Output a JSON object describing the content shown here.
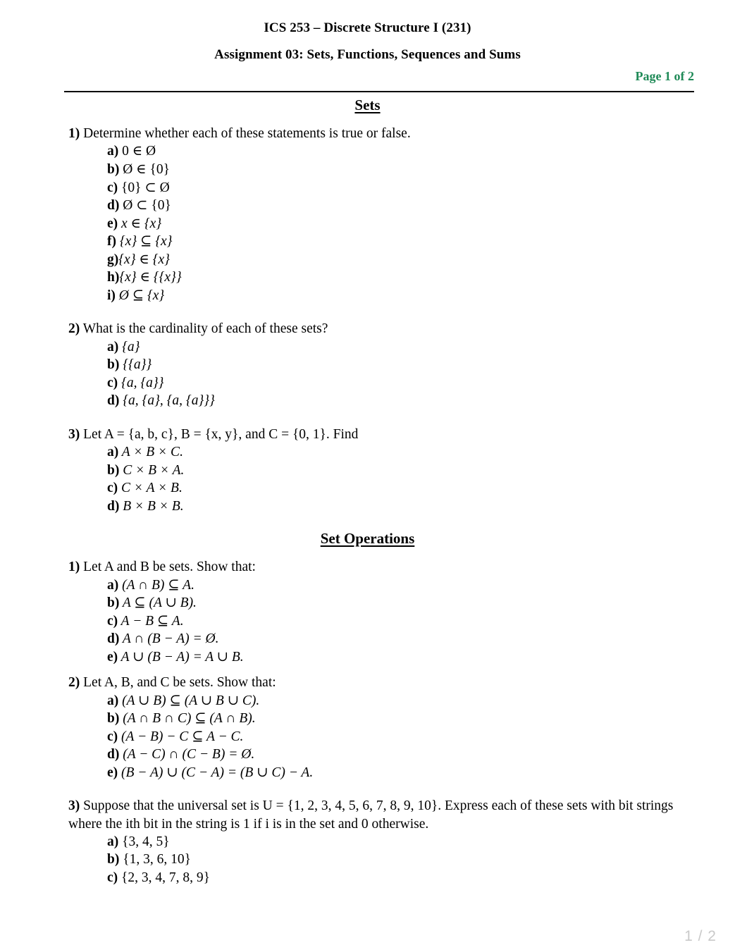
{
  "header": {
    "course_title": "ICS 253 – Discrete Structure I (231)",
    "assignment_title": "Assignment 03: Sets, Functions, Sequences and Sums",
    "page_indicator": "Page 1 of 2",
    "page_indicator_color": "#1f8a57"
  },
  "footer": {
    "page_number": "1 / 2"
  },
  "sections": [
    {
      "heading": "Sets",
      "questions": [
        {
          "number": "1)",
          "prompt": " Determine whether each of these statements is true or false.",
          "items": [
            {
              "label": "a)",
              "text": " 0 ∈ Ø"
            },
            {
              "label": "b)",
              "text": " Ø ∈ {0}"
            },
            {
              "label": "c)",
              "text": " {0} ⊂ Ø"
            },
            {
              "label": "d)",
              "text": " Ø ⊂ {0}"
            },
            {
              "label": "e)",
              "text": " x ∈ {x}"
            },
            {
              "label": "f)",
              "text": " {x} ⊆ {x}"
            },
            {
              "label": "g)",
              "text": "{x} ∈ {x}"
            },
            {
              "label": "h)",
              "text": "{x} ∈ {{x}}"
            },
            {
              "label": "i)",
              "text": " Ø ⊆ {x}"
            }
          ]
        },
        {
          "number": "2)",
          "prompt": " What is the cardinality of each of these sets?",
          "items": [
            {
              "label": "a)",
              "text": " {a}"
            },
            {
              "label": "b)",
              "text": " {{a}}"
            },
            {
              "label": "c)",
              "text": " {a, {a}}"
            },
            {
              "label": "d)",
              "text": " {a, {a}, {a, {a}}}"
            }
          ]
        },
        {
          "number": "3)",
          "prompt": " Let A = {a, b, c}, B = {x, y}, and C = {0, 1}. Find",
          "items": [
            {
              "label": "a)",
              "text": " A × B × C."
            },
            {
              "label": "b)",
              "text": " C × B × A."
            },
            {
              "label": "c)",
              "text": " C × A × B."
            },
            {
              "label": "d)",
              "text": " B × B × B."
            }
          ]
        }
      ]
    },
    {
      "heading": "Set Operations",
      "questions": [
        {
          "number": "1)",
          "prompt": " Let A and B be sets. Show that:",
          "items": [
            {
              "label": "a)",
              "text": " (A ∩ B) ⊆ A."
            },
            {
              "label": "b)",
              "text": " A ⊆ (A ∪ B)."
            },
            {
              "label": "c)",
              "text": " A − B ⊆ A."
            },
            {
              "label": "d)",
              "text": " A ∩ (B − A) = Ø."
            },
            {
              "label": "e)",
              "text": " A ∪ (B − A) = A ∪ B."
            }
          ]
        },
        {
          "number": "2)",
          "prompt": " Let A, B, and C be sets. Show that:",
          "items": [
            {
              "label": "a)",
              "text": " (A ∪ B) ⊆ (A ∪ B ∪ C)."
            },
            {
              "label": "b)",
              "text": " (A ∩ B ∩ C) ⊆ (A ∩ B)."
            },
            {
              "label": "c)",
              "text": " (A − B) − C ⊆ A − C."
            },
            {
              "label": "d)",
              "text": " (A − C) ∩ (C − B) = Ø."
            },
            {
              "label": "e)",
              "text": " (B − A) ∪ (C − A) = (B ∪ C) − A."
            }
          ]
        },
        {
          "number": "3)",
          "prompt": " Suppose that the universal set is U = {1, 2, 3, 4, 5, 6, 7, 8, 9, 10}. Express each of these sets with bit strings where the ith bit in the string is 1 if i is in the set and 0 otherwise.",
          "items": [
            {
              "label": "a)",
              "text": " {3, 4, 5}"
            },
            {
              "label": "b)",
              "text": " {1, 3, 6, 10}"
            },
            {
              "label": "c)",
              "text": " {2, 3, 4, 7, 8, 9}"
            }
          ]
        }
      ]
    }
  ]
}
